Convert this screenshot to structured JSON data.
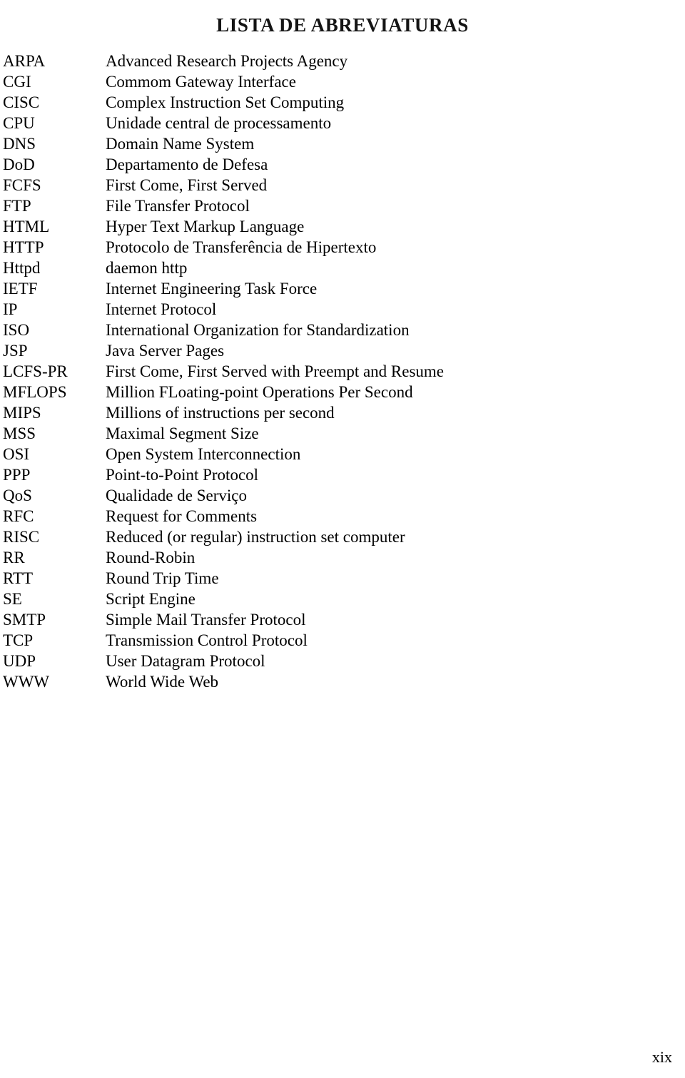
{
  "document": {
    "title": "LISTA DE ABREVIATURAS",
    "page_number": "xix",
    "text_color": "#000000",
    "background_color": "#ffffff"
  },
  "abbreviations": [
    {
      "term": "ARPA",
      "definition": "Advanced Research Projects Agency"
    },
    {
      "term": "CGI",
      "definition": "Commom Gateway Interface"
    },
    {
      "term": "CISC",
      "definition": "Complex Instruction Set Computing"
    },
    {
      "term": "CPU",
      "definition": "Unidade central de processamento"
    },
    {
      "term": "DNS",
      "definition": "Domain Name System"
    },
    {
      "term": "DoD",
      "definition": "Departamento de Defesa"
    },
    {
      "term": "FCFS",
      "definition": "First Come, First Served"
    },
    {
      "term": "FTP",
      "definition": "File Transfer Protocol"
    },
    {
      "term": "HTML",
      "definition": "Hyper Text Markup Language"
    },
    {
      "term": "HTTP",
      "definition": "Protocolo de Transferência de Hipertexto"
    },
    {
      "term": "Httpd",
      "definition": "daemon http"
    },
    {
      "term": "IETF",
      "definition": "Internet Engineering Task Force"
    },
    {
      "term": "IP",
      "definition": "Internet Protocol"
    },
    {
      "term": "ISO",
      "definition": "International Organization for Standardization"
    },
    {
      "term": "JSP",
      "definition": "Java Server Pages"
    },
    {
      "term": "LCFS-PR",
      "definition": "First Come, First Served with Preempt and Resume"
    },
    {
      "term": "MFLOPS",
      "definition": "Million FLoating-point Operations Per Second"
    },
    {
      "term": "MIPS",
      "definition": "Millions of instructions per second"
    },
    {
      "term": "MSS",
      "definition": "Maximal Segment Size"
    },
    {
      "term": "OSI",
      "definition": "Open System Interconnection"
    },
    {
      "term": "PPP",
      "definition": "Point-to-Point Protocol"
    },
    {
      "term": "QoS",
      "definition": "Qualidade de Serviço"
    },
    {
      "term": "RFC",
      "definition": "Request for Comments"
    },
    {
      "term": "RISC",
      "definition": "Reduced (or regular) instruction set computer"
    },
    {
      "term": "RR",
      "definition": "Round-Robin"
    },
    {
      "term": "RTT",
      "definition": "Round Trip Time"
    },
    {
      "term": "SE",
      "definition": "Script Engine"
    },
    {
      "term": "SMTP",
      "definition": "Simple Mail Transfer Protocol"
    },
    {
      "term": "TCP",
      "definition": "Transmission Control Protocol"
    },
    {
      "term": "UDP",
      "definition": "User Datagram Protocol"
    },
    {
      "term": "WWW",
      "definition": "World Wide Web"
    }
  ]
}
